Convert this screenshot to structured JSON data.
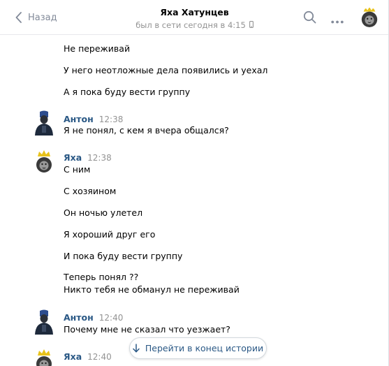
{
  "header": {
    "back_label": "Назад",
    "title": "Яха Хатунцев",
    "status": "был в сети сегодня в 4:15",
    "icons": [
      "back-chevron-icon",
      "phone-icon",
      "search-icon",
      "more-dots-icon",
      "lion-avatar"
    ]
  },
  "messages": {
    "m1": "Не переживай",
    "m2": "У него неотложные дела появились и уехал",
    "m3": "А я пока буду вести группу",
    "g1": {
      "author": "Антон",
      "time": "12:38",
      "text": "Я не понял, с кем я вчера общался?"
    },
    "g2": {
      "author": "Яха",
      "time": "12:38",
      "lines": [
        "С ним",
        "С хозяином",
        "Он ночью улетел",
        "Я хороший друг его",
        "И пока буду вести группу",
        "Теперь понял ??",
        "Никто тебя не обманул не переживай"
      ]
    },
    "g3": {
      "author": "Антон",
      "time": "12:40",
      "text": "Почему мне не сказал что уезжает?"
    },
    "g4": {
      "author": "Яха",
      "time": "12:40"
    }
  },
  "jump_button": {
    "label": "Перейти в конец истории",
    "icon": "arrow-down-icon"
  },
  "colors": {
    "link": "#2a5885",
    "muted": "#939393",
    "back": "#828a99",
    "border": "#e7e8ec"
  }
}
